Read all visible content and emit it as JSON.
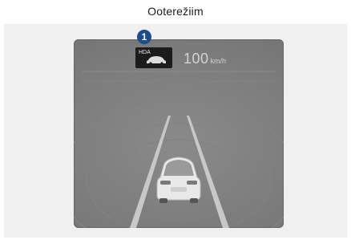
{
  "title": "Ooterežiim",
  "callout": {
    "number": "1"
  },
  "hda": {
    "label": "HDA",
    "icon": "car-front-icon"
  },
  "speed": {
    "value": "100",
    "unit": "km/h"
  },
  "colors": {
    "display_bg": "#7b7b7b",
    "badge_bg": "#1c1c1c",
    "callout_bg": "#1d4d8c",
    "lane_line": "#c8c8c8"
  }
}
